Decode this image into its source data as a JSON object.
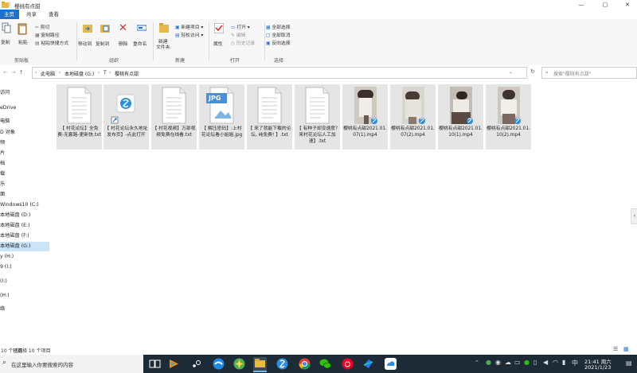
{
  "window": {
    "title": "樱桃有点甜",
    "minimize": "—",
    "maximize": "▢",
    "close": "✕"
  },
  "tabs": [
    "主页",
    "共享",
    "查看"
  ],
  "ribbon": {
    "clipboard": {
      "copy": "复制",
      "paste": "粘贴",
      "cut": "剪切",
      "copy_path": "复制路径",
      "paste_shortcut": "粘贴快捷方式",
      "label": "剪贴板"
    },
    "organize": {
      "move_to": "移动到",
      "copy_to": "复制到",
      "delete": "删除",
      "rename": "重命名",
      "label": "组织"
    },
    "new": {
      "new_folder": "新建\n文件夹",
      "new_item": "新建项目",
      "easy_access": "轻松访问",
      "label": "新建"
    },
    "open": {
      "properties": "属性",
      "open": "打开",
      "edit": "编辑",
      "history": "历史记录",
      "label": "打开"
    },
    "select": {
      "select_all": "全部选择",
      "select_none": "全部取消",
      "invert": "反向选择",
      "label": "选择"
    }
  },
  "address": {
    "crumbs": [
      "此电脑",
      "本地磁盘 (G:)",
      "T",
      "樱桃有点甜"
    ],
    "search_placeholder": "搜索\"樱桃有点甜\""
  },
  "sidebar": [
    "访问",
    "eDrive",
    "电脑",
    "D 对象",
    "频",
    "片",
    "档",
    "载",
    "乐",
    "面",
    "Windows10 (C:)",
    "本地磁盘 (D:)",
    "本地磁盘 (E:)",
    "本地磁盘 (F:)",
    "本地磁盘 (G:)",
    "y (H:)",
    "9 (I:)",
    "(I:)",
    "(H:)",
    "络"
  ],
  "files": [
    {
      "name": "【 村花论坛】全免费-无套路-更新快.txt",
      "type": "txt"
    },
    {
      "name": "【 村花论坛永久地址发布页】-点此打开",
      "type": "url"
    },
    {
      "name": "【 村花视频】万部视频免费在线看.txt",
      "type": "txt"
    },
    {
      "name": "【 解压密码】:上村花论坛看小姐姐.jpg",
      "type": "jpg",
      "badge": "JPG"
    },
    {
      "name": "【 来了就能下载的论坛, 纯免费! 】.txt",
      "type": "txt"
    },
    {
      "name": "【 有种子却没速度? 来村花论坛人工加速】.txt",
      "type": "txt"
    },
    {
      "name": "樱桃有点甜2021.01.07(1).mp4",
      "type": "mp4"
    },
    {
      "name": "樱桃有点甜2021.01.07(2).mp4",
      "type": "mp4"
    },
    {
      "name": "樱桃有点甜2021.01.10(1).mp4",
      "type": "mp4"
    },
    {
      "name": "樱桃有点甜2021.01.10(2).mp4",
      "type": "mp4"
    }
  ],
  "status": {
    "count": "10 个项目",
    "selected": "已选择 10 个项目"
  },
  "taskbar": {
    "search_placeholder": "在这里输入你要搜索的内容",
    "time": "21:41 周六",
    "date": "2021/1/23"
  }
}
